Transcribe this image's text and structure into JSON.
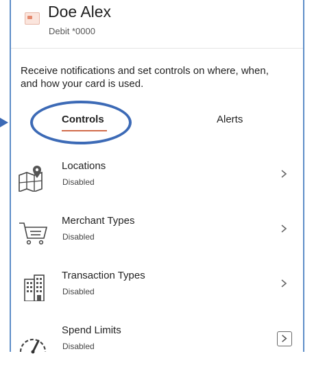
{
  "header": {
    "name": "Doe Alex",
    "account": "Debit *0000"
  },
  "description": "Receive notifications and set controls on where, when, and how your card is used.",
  "tabs": [
    {
      "label": "Controls",
      "selected": true
    },
    {
      "label": "Alerts",
      "selected": false
    }
  ],
  "controls": [
    {
      "title": "Locations",
      "status": "Disabled",
      "icon": "map-pin-icon"
    },
    {
      "title": "Merchant Types",
      "status": "Disabled",
      "icon": "shopping-cart-icon"
    },
    {
      "title": "Transaction Types",
      "status": "Disabled",
      "icon": "building-icon"
    },
    {
      "title": "Spend Limits",
      "status": "Disabled",
      "icon": "speedometer-icon"
    }
  ],
  "colors": {
    "accent_underline": "#d06a48",
    "annotation": "#3c6ab6",
    "frame_border": "#5b8cc7"
  }
}
